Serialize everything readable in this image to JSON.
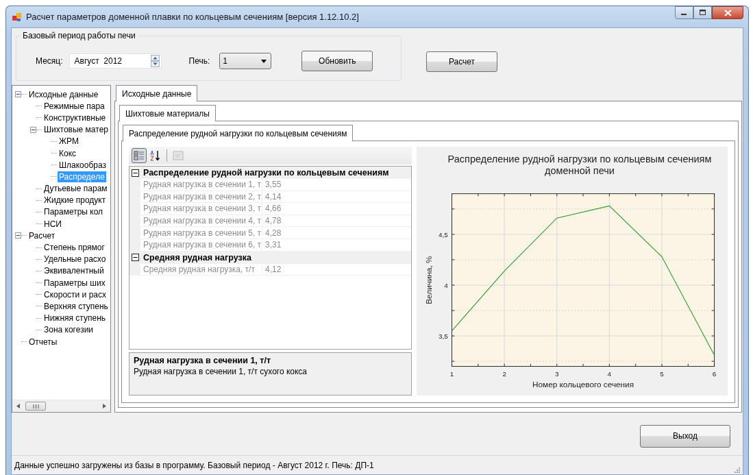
{
  "window": {
    "title": "Расчет параметров доменной плавки по кольцевым сечениям [версия 1.12.10.2]"
  },
  "period_group": {
    "title": "Базовый период работы печи",
    "month_label": "Месяц:",
    "month_value": "Август  2012",
    "furnace_label": "Печь:",
    "furnace_value": "1",
    "refresh_button": "Обновить"
  },
  "calc_button": "Расчет",
  "tree": [
    {
      "label": "Исходные данные",
      "expanded": true,
      "selected": false,
      "children": [
        {
          "label": "Режимные пара",
          "selected": false
        },
        {
          "label": "Конструктивные",
          "selected": false
        },
        {
          "label": "Шихтовые матер",
          "expanded": true,
          "selected": false,
          "children": [
            {
              "label": "ЖРМ",
              "selected": false
            },
            {
              "label": "Кокс",
              "selected": false
            },
            {
              "label": "Шлакообраз",
              "selected": false
            },
            {
              "label": "Распределе",
              "selected": true
            }
          ]
        },
        {
          "label": "Дутьевые парам",
          "selected": false
        },
        {
          "label": "Жидкие продукт",
          "selected": false
        },
        {
          "label": "Параметры кол",
          "selected": false
        },
        {
          "label": "НСИ",
          "selected": false
        }
      ]
    },
    {
      "label": "Расчет",
      "expanded": true,
      "selected": false,
      "children": [
        {
          "label": "Степень прямог",
          "selected": false
        },
        {
          "label": "Удельные расхо",
          "selected": false
        },
        {
          "label": "Эквивалентный",
          "selected": false
        },
        {
          "label": "Параметры ших",
          "selected": false
        },
        {
          "label": "Скорости и расх",
          "selected": false
        },
        {
          "label": "Верхняя ступень",
          "selected": false
        },
        {
          "label": "Нижняя ступень",
          "selected": false
        },
        {
          "label": "Зона когезии",
          "selected": false
        }
      ]
    },
    {
      "label": "Отчеты",
      "selected": false
    }
  ],
  "tabs": [
    {
      "label": "Исходные данные",
      "selected": true
    }
  ],
  "subtabs": [
    {
      "label": "Шихтовые материалы",
      "selected": true
    }
  ],
  "inner_tabs": [
    {
      "label": "Распределение рудной нагрузки по кольцевым сечениям",
      "selected": true
    }
  ],
  "property_grid": {
    "toolbar": [
      {
        "kind": "categorized",
        "selected": true,
        "disabled": false
      },
      {
        "kind": "alphabetical",
        "selected": false,
        "disabled": false
      },
      {
        "kind": "pages",
        "selected": false,
        "disabled": true
      }
    ],
    "categories": [
      {
        "title": "Распределение рудной нагрузки по кольцевым сечениям",
        "expanded": true,
        "rows": [
          {
            "label": "Рудная нагрузка в сечении 1, т",
            "value": "3,55"
          },
          {
            "label": "Рудная нагрузка в сечении 2, т",
            "value": "4,14"
          },
          {
            "label": "Рудная нагрузка в сечении 3, т",
            "value": "4,66"
          },
          {
            "label": "Рудная нагрузка в сечении 4, т",
            "value": "4,78"
          },
          {
            "label": "Рудная нагрузка в сечении 5, т",
            "value": "4,28"
          },
          {
            "label": "Рудная нагрузка в сечении 6, т",
            "value": "3,31"
          }
        ]
      },
      {
        "title": "Средняя рудная нагрузка",
        "expanded": true,
        "rows": [
          {
            "label": "Средняя рудная нагрузка, т/т",
            "value": "4,12"
          }
        ]
      }
    ],
    "help": {
      "title": "Рудная нагрузка в сечении 1, т/т",
      "text": "Рудная нагрузка в сечении 1, т/т сухого кокса"
    }
  },
  "chart": {
    "chart_data": {
      "type": "line",
      "title": "Распределение рудной нагрузки по кольцевым сечениям доменной печи",
      "xlabel": "Номер кольцевого сечения",
      "ylabel": "Величина, %",
      "x": [
        1,
        2,
        3,
        4,
        5,
        6
      ],
      "series": [
        {
          "color": "#2e9a2e",
          "values": [
            3.55,
            4.14,
            4.66,
            4.78,
            4.28,
            3.31
          ]
        }
      ],
      "xlim": [
        1,
        6
      ],
      "ylim": [
        3.2,
        4.9
      ],
      "grid": true,
      "xticks": [
        1,
        2,
        3,
        4,
        5,
        6
      ],
      "yticks": [
        {
          "value": 3.5,
          "label": "3,5"
        },
        {
          "value": 4,
          "label": "4"
        },
        {
          "value": 4.5,
          "label": "4,5"
        }
      ]
    }
  },
  "exit_button": "Выход",
  "status_bar": "Данные успешно загружены из базы в программу. Базовый период - Август 2012 г. Печь: ДП-1"
}
